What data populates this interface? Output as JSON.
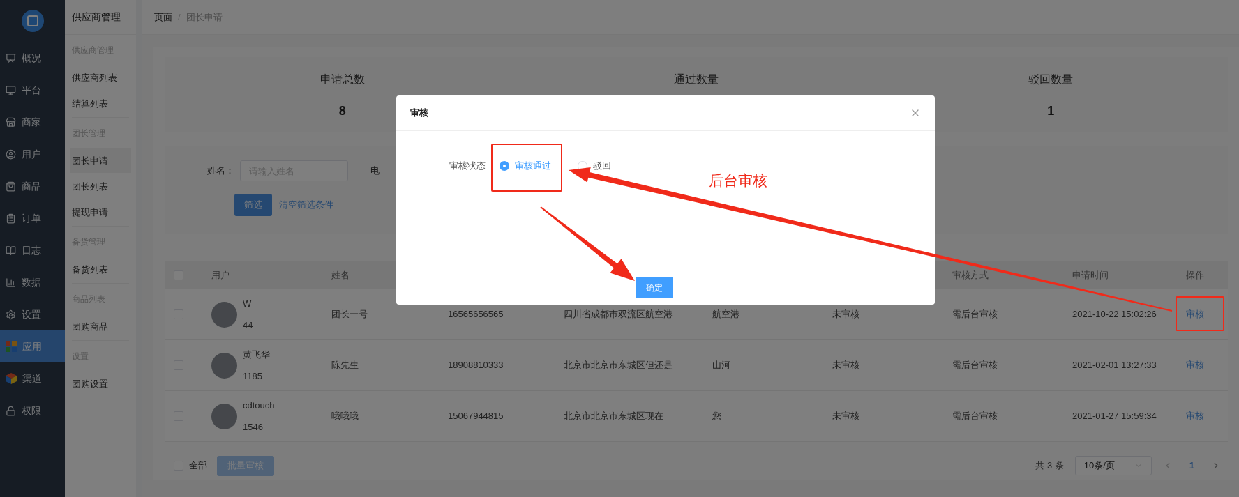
{
  "sidebar": {
    "items": [
      {
        "label": "概况",
        "selected": false
      },
      {
        "label": "平台",
        "selected": false
      },
      {
        "label": "商家",
        "selected": false
      },
      {
        "label": "用户",
        "selected": false
      },
      {
        "label": "商品",
        "selected": false
      },
      {
        "label": "订单",
        "selected": false
      },
      {
        "label": "日志",
        "selected": false
      },
      {
        "label": "数据",
        "selected": false
      },
      {
        "label": "设置",
        "selected": false
      },
      {
        "label": "应用",
        "selected": true
      },
      {
        "label": "渠道",
        "selected": false
      },
      {
        "label": "权限",
        "selected": false
      }
    ]
  },
  "subnav": {
    "title": "供应商管理",
    "groups": [
      {
        "heading": "供应商管理",
        "items": [
          {
            "label": "供应商列表",
            "selected": false
          },
          {
            "label": "结算列表",
            "selected": false
          }
        ]
      },
      {
        "heading": "团长管理",
        "items": [
          {
            "label": "团长申请",
            "selected": true
          },
          {
            "label": "团长列表",
            "selected": false
          },
          {
            "label": "提现申请",
            "selected": false
          }
        ]
      },
      {
        "heading": "备货管理",
        "items": [
          {
            "label": "备货列表",
            "selected": false
          }
        ]
      },
      {
        "heading": "商品列表",
        "items": [
          {
            "label": "团购商品",
            "selected": false
          }
        ]
      },
      {
        "heading": "设置",
        "items": [
          {
            "label": "团购设置",
            "selected": false
          }
        ]
      }
    ]
  },
  "breadcrumb": {
    "items": [
      "页面",
      "团长申请"
    ],
    "separator": "/"
  },
  "stats": [
    {
      "label": "申请总数",
      "value": "8"
    },
    {
      "label": "通过数量"
    },
    {
      "label": "驳回数量",
      "value": "1"
    }
  ],
  "filter": {
    "fields": [
      {
        "label": "姓名：",
        "placeholder": "请输入姓名"
      },
      {
        "label": "电"
      }
    ],
    "filter_button": "筛选",
    "clear_link": "清空筛选条件"
  },
  "table": {
    "header_checked": false,
    "columns": [
      "用户",
      "姓名",
      null,
      null,
      null,
      null,
      "审核方式",
      "申请时间",
      "操作"
    ],
    "rows": [
      {
        "checked": false,
        "user_name": "W",
        "user_id": "44",
        "name": "团长一号",
        "phone": "16565656565",
        "address": "四川省成都市双流区航空港",
        "column_6": "航空港",
        "status": "未审核",
        "review_method": "需后台审核",
        "time": "2021-10-22 15:02:26",
        "action": "审核"
      },
      {
        "checked": false,
        "user_name": "黄飞华",
        "user_id": "1185",
        "name": "陈先生",
        "phone": "18908810333",
        "address": "北京市北京市东城区但还是",
        "column_6": "山河",
        "status": "未审核",
        "review_method": "需后台审核",
        "time": "2021-02-01 13:27:33",
        "action": "审核"
      },
      {
        "checked": false,
        "user_name": "cdtouch",
        "user_id": "1546",
        "name": "哦哦哦",
        "phone": "15067944815",
        "address": "北京市北京市东城区现在",
        "column_6": "您",
        "status": "未审核",
        "review_method": "需后台审核",
        "time": "2021-01-27 15:59:34",
        "action": "审核"
      }
    ]
  },
  "footer": {
    "select_all": {
      "label": "全部",
      "checked": false
    },
    "batch_button": {
      "label": "批量审核",
      "disabled": true
    },
    "total": "共 3 条",
    "page_size": "10条/页",
    "pages": [
      {
        "label": "1",
        "selected": true
      }
    ]
  },
  "modal": {
    "title": "审核",
    "field_label": "审核状态",
    "options": [
      {
        "label": "审核通过",
        "selected": true
      },
      {
        "label": "驳回",
        "selected": false
      }
    ],
    "ok_button": "确定"
  },
  "annotation": {
    "note": "后台审核"
  }
}
